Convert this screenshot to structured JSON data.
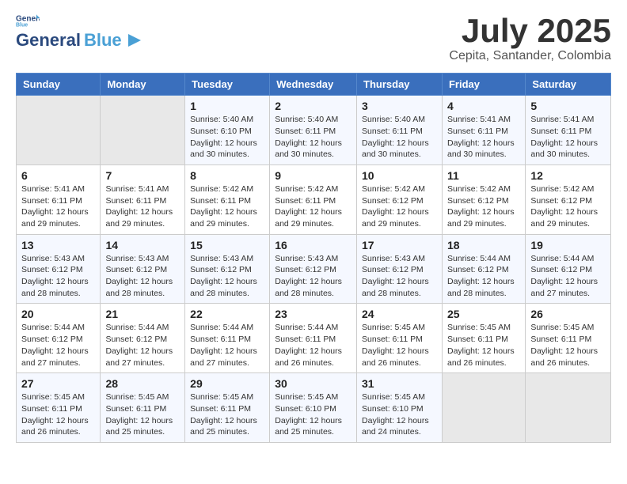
{
  "header": {
    "logo_general": "General",
    "logo_blue": "Blue",
    "month_year": "July 2025",
    "location": "Cepita, Santander, Colombia"
  },
  "weekdays": [
    "Sunday",
    "Monday",
    "Tuesday",
    "Wednesday",
    "Thursday",
    "Friday",
    "Saturday"
  ],
  "weeks": [
    [
      {
        "day": "",
        "content": ""
      },
      {
        "day": "",
        "content": ""
      },
      {
        "day": "1",
        "content": "Sunrise: 5:40 AM\nSunset: 6:10 PM\nDaylight: 12 hours\nand 30 minutes."
      },
      {
        "day": "2",
        "content": "Sunrise: 5:40 AM\nSunset: 6:11 PM\nDaylight: 12 hours\nand 30 minutes."
      },
      {
        "day": "3",
        "content": "Sunrise: 5:40 AM\nSunset: 6:11 PM\nDaylight: 12 hours\nand 30 minutes."
      },
      {
        "day": "4",
        "content": "Sunrise: 5:41 AM\nSunset: 6:11 PM\nDaylight: 12 hours\nand 30 minutes."
      },
      {
        "day": "5",
        "content": "Sunrise: 5:41 AM\nSunset: 6:11 PM\nDaylight: 12 hours\nand 30 minutes."
      }
    ],
    [
      {
        "day": "6",
        "content": "Sunrise: 5:41 AM\nSunset: 6:11 PM\nDaylight: 12 hours\nand 29 minutes."
      },
      {
        "day": "7",
        "content": "Sunrise: 5:41 AM\nSunset: 6:11 PM\nDaylight: 12 hours\nand 29 minutes."
      },
      {
        "day": "8",
        "content": "Sunrise: 5:42 AM\nSunset: 6:11 PM\nDaylight: 12 hours\nand 29 minutes."
      },
      {
        "day": "9",
        "content": "Sunrise: 5:42 AM\nSunset: 6:11 PM\nDaylight: 12 hours\nand 29 minutes."
      },
      {
        "day": "10",
        "content": "Sunrise: 5:42 AM\nSunset: 6:12 PM\nDaylight: 12 hours\nand 29 minutes."
      },
      {
        "day": "11",
        "content": "Sunrise: 5:42 AM\nSunset: 6:12 PM\nDaylight: 12 hours\nand 29 minutes."
      },
      {
        "day": "12",
        "content": "Sunrise: 5:42 AM\nSunset: 6:12 PM\nDaylight: 12 hours\nand 29 minutes."
      }
    ],
    [
      {
        "day": "13",
        "content": "Sunrise: 5:43 AM\nSunset: 6:12 PM\nDaylight: 12 hours\nand 28 minutes."
      },
      {
        "day": "14",
        "content": "Sunrise: 5:43 AM\nSunset: 6:12 PM\nDaylight: 12 hours\nand 28 minutes."
      },
      {
        "day": "15",
        "content": "Sunrise: 5:43 AM\nSunset: 6:12 PM\nDaylight: 12 hours\nand 28 minutes."
      },
      {
        "day": "16",
        "content": "Sunrise: 5:43 AM\nSunset: 6:12 PM\nDaylight: 12 hours\nand 28 minutes."
      },
      {
        "day": "17",
        "content": "Sunrise: 5:43 AM\nSunset: 6:12 PM\nDaylight: 12 hours\nand 28 minutes."
      },
      {
        "day": "18",
        "content": "Sunrise: 5:44 AM\nSunset: 6:12 PM\nDaylight: 12 hours\nand 28 minutes."
      },
      {
        "day": "19",
        "content": "Sunrise: 5:44 AM\nSunset: 6:12 PM\nDaylight: 12 hours\nand 27 minutes."
      }
    ],
    [
      {
        "day": "20",
        "content": "Sunrise: 5:44 AM\nSunset: 6:12 PM\nDaylight: 12 hours\nand 27 minutes."
      },
      {
        "day": "21",
        "content": "Sunrise: 5:44 AM\nSunset: 6:12 PM\nDaylight: 12 hours\nand 27 minutes."
      },
      {
        "day": "22",
        "content": "Sunrise: 5:44 AM\nSunset: 6:11 PM\nDaylight: 12 hours\nand 27 minutes."
      },
      {
        "day": "23",
        "content": "Sunrise: 5:44 AM\nSunset: 6:11 PM\nDaylight: 12 hours\nand 26 minutes."
      },
      {
        "day": "24",
        "content": "Sunrise: 5:45 AM\nSunset: 6:11 PM\nDaylight: 12 hours\nand 26 minutes."
      },
      {
        "day": "25",
        "content": "Sunrise: 5:45 AM\nSunset: 6:11 PM\nDaylight: 12 hours\nand 26 minutes."
      },
      {
        "day": "26",
        "content": "Sunrise: 5:45 AM\nSunset: 6:11 PM\nDaylight: 12 hours\nand 26 minutes."
      }
    ],
    [
      {
        "day": "27",
        "content": "Sunrise: 5:45 AM\nSunset: 6:11 PM\nDaylight: 12 hours\nand 26 minutes."
      },
      {
        "day": "28",
        "content": "Sunrise: 5:45 AM\nSunset: 6:11 PM\nDaylight: 12 hours\nand 25 minutes."
      },
      {
        "day": "29",
        "content": "Sunrise: 5:45 AM\nSunset: 6:11 PM\nDaylight: 12 hours\nand 25 minutes."
      },
      {
        "day": "30",
        "content": "Sunrise: 5:45 AM\nSunset: 6:10 PM\nDaylight: 12 hours\nand 25 minutes."
      },
      {
        "day": "31",
        "content": "Sunrise: 5:45 AM\nSunset: 6:10 PM\nDaylight: 12 hours\nand 24 minutes."
      },
      {
        "day": "",
        "content": ""
      },
      {
        "day": "",
        "content": ""
      }
    ]
  ]
}
